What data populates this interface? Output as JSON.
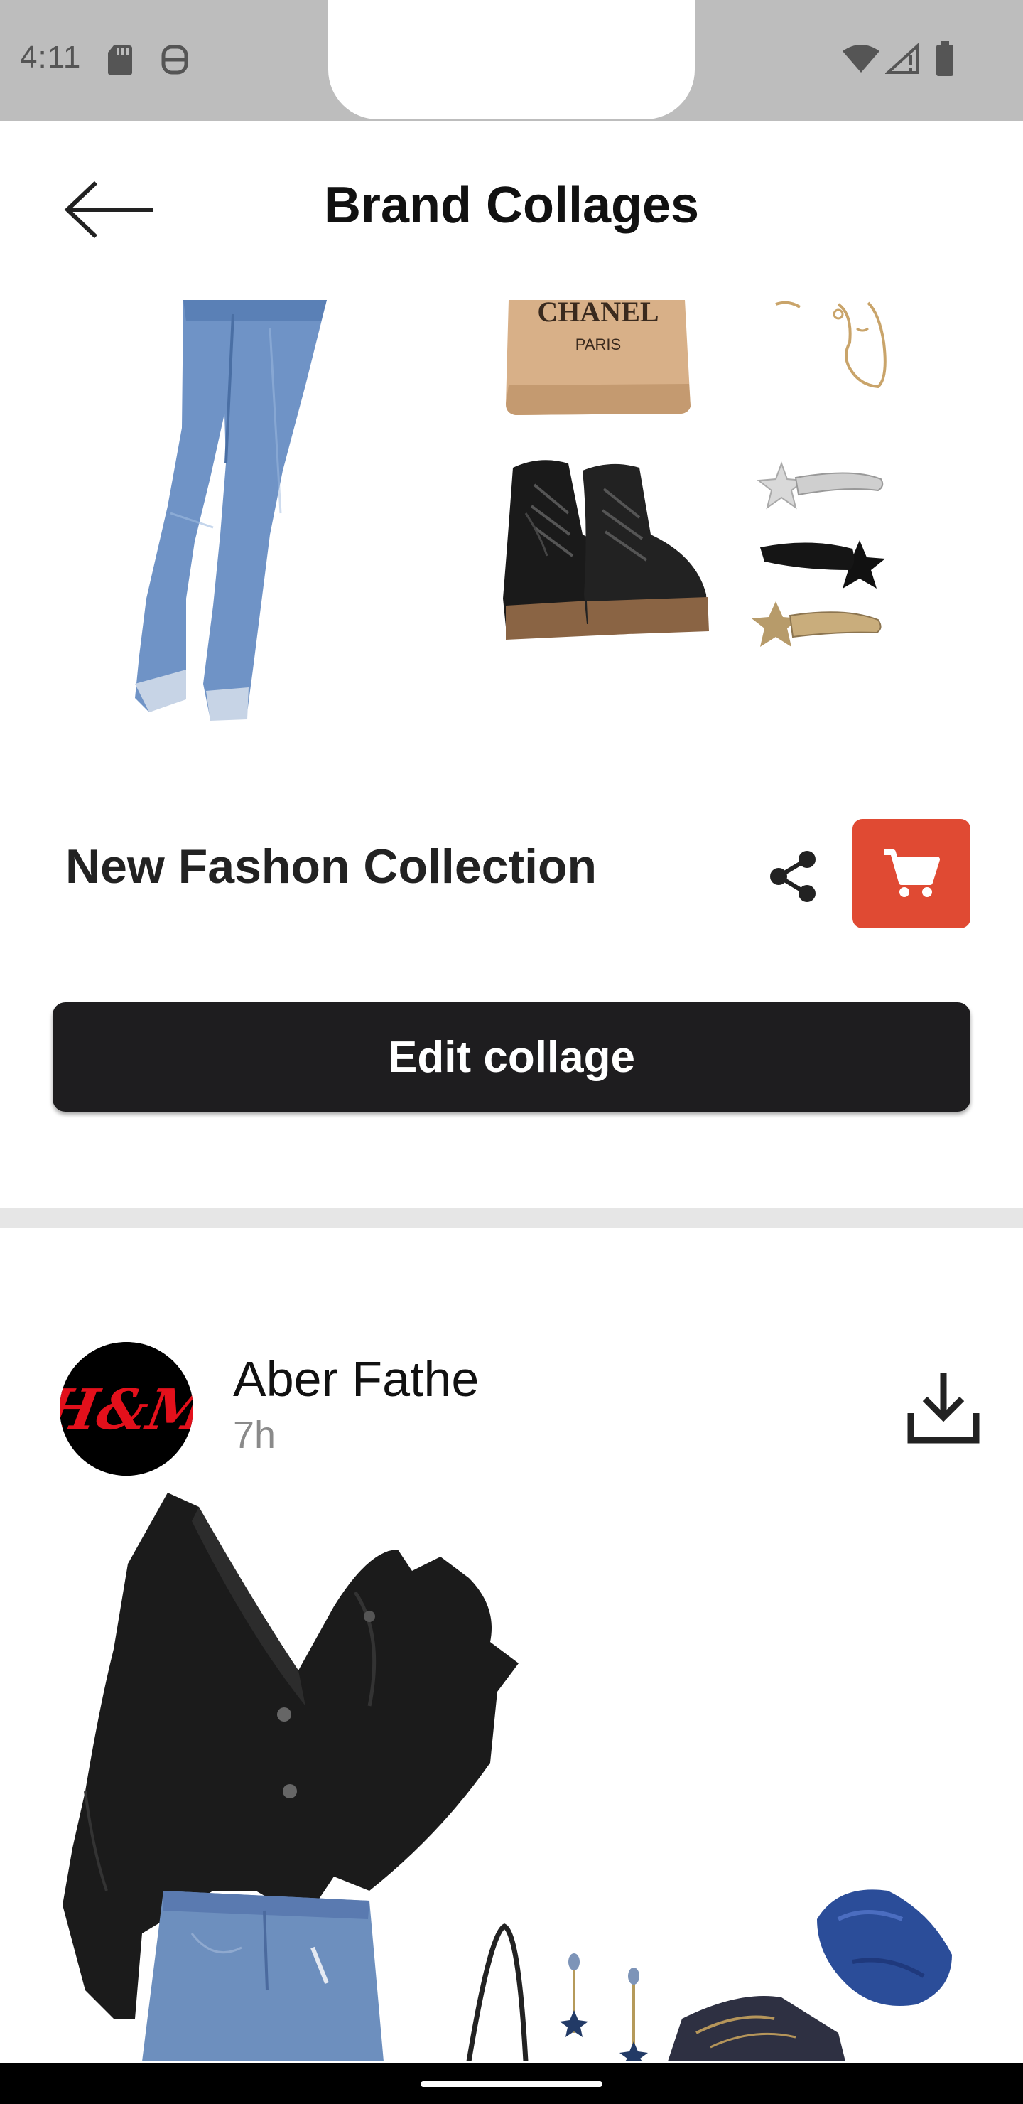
{
  "status_bar": {
    "time": "4:11",
    "icons": [
      "sd-card-icon",
      "accessibility-icon",
      "wifi-icon",
      "signal-icon",
      "battery-icon"
    ]
  },
  "header": {
    "title": "Brand Collages",
    "back_icon": "arrow-left-icon"
  },
  "collage_card": {
    "image_items": [
      "jeans",
      "CHANEL",
      "PARIS",
      "boots",
      "earrings",
      "star-hair-clips"
    ],
    "brand_text": "CHANEL",
    "brand_subtext": "PARIS",
    "title": "New Fashon Collection",
    "share_icon": "share-icon",
    "cart_icon": "cart-icon",
    "edit_label": "Edit collage"
  },
  "post": {
    "author": "Aber Fathe",
    "time_ago": "7h",
    "avatar_text": "H&M",
    "download_icon": "download-icon",
    "image_items": [
      "black-cardigan",
      "denim-shorts",
      "bag",
      "earrings",
      "eyeshadow",
      "book"
    ]
  },
  "colors": {
    "status_bar": "#bdbdbd",
    "accent": "#e04a33",
    "button_dark": "#1e1d1f",
    "divider": "#e6e6e6"
  }
}
